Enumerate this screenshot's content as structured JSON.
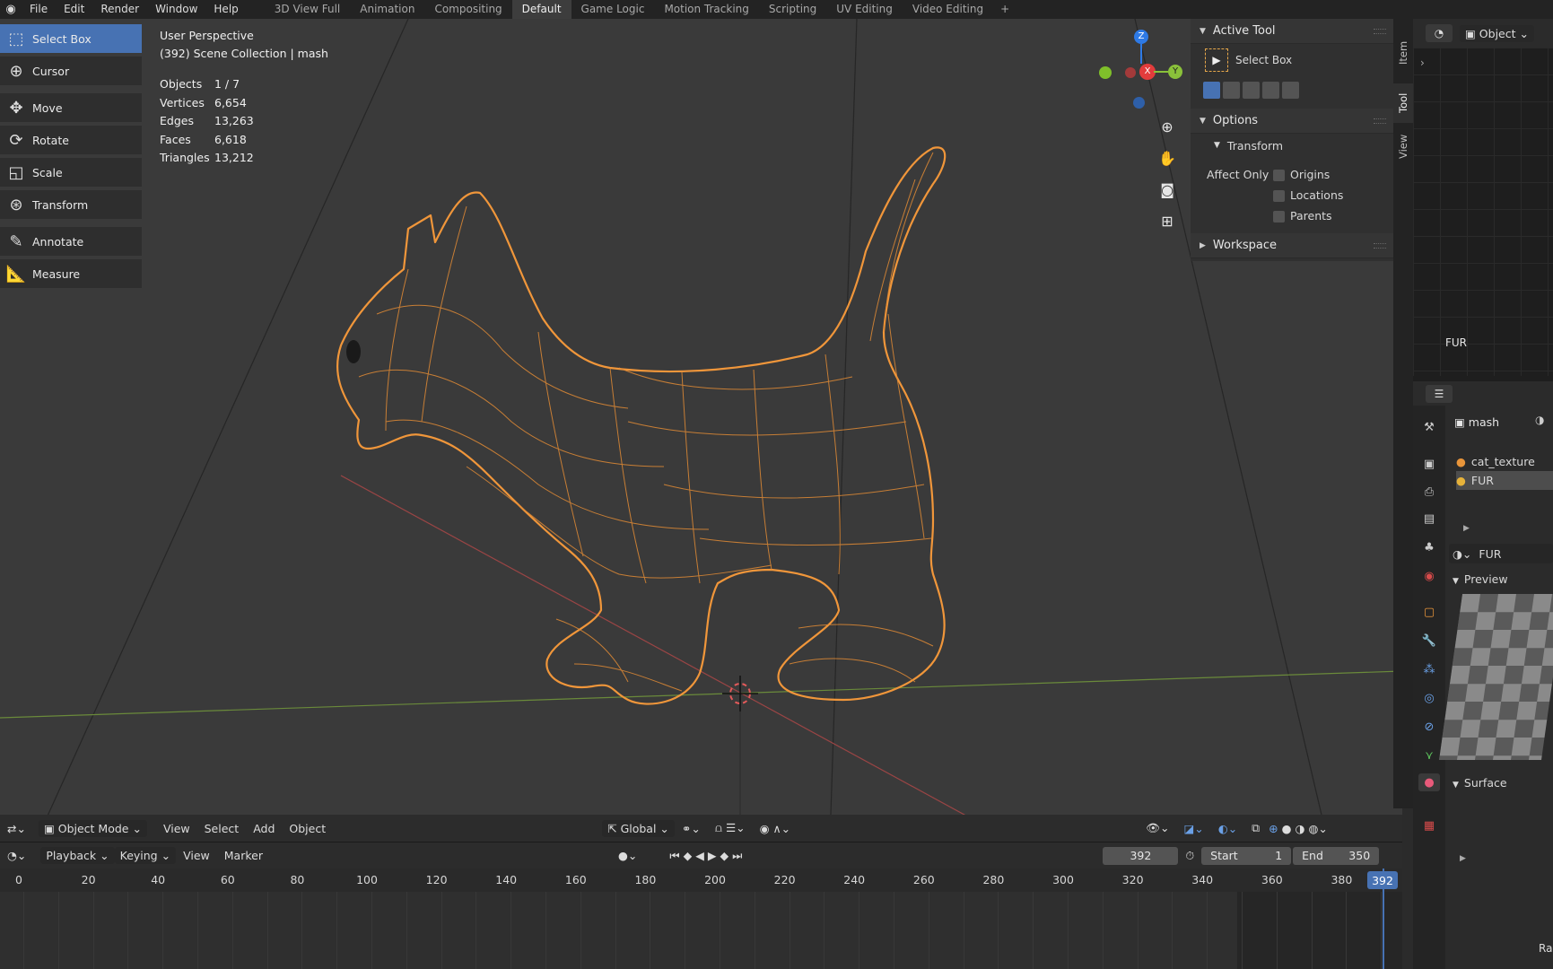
{
  "topbar": {
    "menus": [
      "File",
      "Edit",
      "Render",
      "Window",
      "Help"
    ],
    "workspaces": [
      "3D View Full",
      "Animation",
      "Compositing",
      "Default",
      "Game Logic",
      "Motion Tracking",
      "Scripting",
      "UV Editing",
      "Video Editing"
    ],
    "active_workspace": "Default",
    "add_label": "+"
  },
  "toolbar": {
    "tools": [
      {
        "label": "Select Box",
        "icon": "select-box-icon",
        "active": true
      },
      {
        "label": "Cursor",
        "icon": "cursor-icon"
      },
      {
        "label": "Move",
        "icon": "move-icon"
      },
      {
        "label": "Rotate",
        "icon": "rotate-icon"
      },
      {
        "label": "Scale",
        "icon": "scale-icon"
      },
      {
        "label": "Transform",
        "icon": "transform-icon"
      },
      {
        "label": "Annotate",
        "icon": "annotate-icon"
      },
      {
        "label": "Measure",
        "icon": "measure-icon"
      }
    ]
  },
  "viewport": {
    "perspective": "User Perspective",
    "collection": "(392) Scene Collection | mash",
    "stats": [
      {
        "key": "Objects",
        "value": "1 / 7"
      },
      {
        "key": "Vertices",
        "value": "6,654"
      },
      {
        "key": "Edges",
        "value": "13,263"
      },
      {
        "key": "Faces",
        "value": "6,618"
      },
      {
        "key": "Triangles",
        "value": "13,212"
      }
    ],
    "gizmo": {
      "z": "Z",
      "x": "X",
      "y": "Y"
    },
    "wire_color": "#f0963a"
  },
  "npanel": {
    "active_tool_title": "Active Tool",
    "active_tool_name": "Select Box",
    "options_title": "Options",
    "transform_title": "Transform",
    "affect_only_label": "Affect Only",
    "checkboxes": [
      "Origins",
      "Locations",
      "Parents"
    ],
    "workspace_title": "Workspace",
    "tabs": [
      "Item",
      "Tool",
      "View"
    ]
  },
  "node_editor": {
    "mode": "Object",
    "material_label": "FUR"
  },
  "properties": {
    "object_name": "mash",
    "materials": [
      "cat_texture",
      "FUR"
    ],
    "material_name": "FUR",
    "preview_title": "Preview",
    "surface_title": "Surface",
    "footer_label": "Ra"
  },
  "vp_header": {
    "mode": "Object Mode",
    "menus": [
      "View",
      "Select",
      "Add",
      "Object"
    ],
    "orientation": "Global"
  },
  "timeline": {
    "menus": [
      "Playback",
      "Keying",
      "View",
      "Marker"
    ],
    "current_frame": "392",
    "start_label": "Start",
    "start": "1",
    "end_label": "End",
    "end": "350",
    "ticks": [
      "0",
      "20",
      "40",
      "60",
      "80",
      "100",
      "120",
      "140",
      "160",
      "180",
      "200",
      "220",
      "240",
      "260",
      "280",
      "300",
      "320",
      "340",
      "360",
      "380"
    ],
    "playhead_label": "392"
  }
}
